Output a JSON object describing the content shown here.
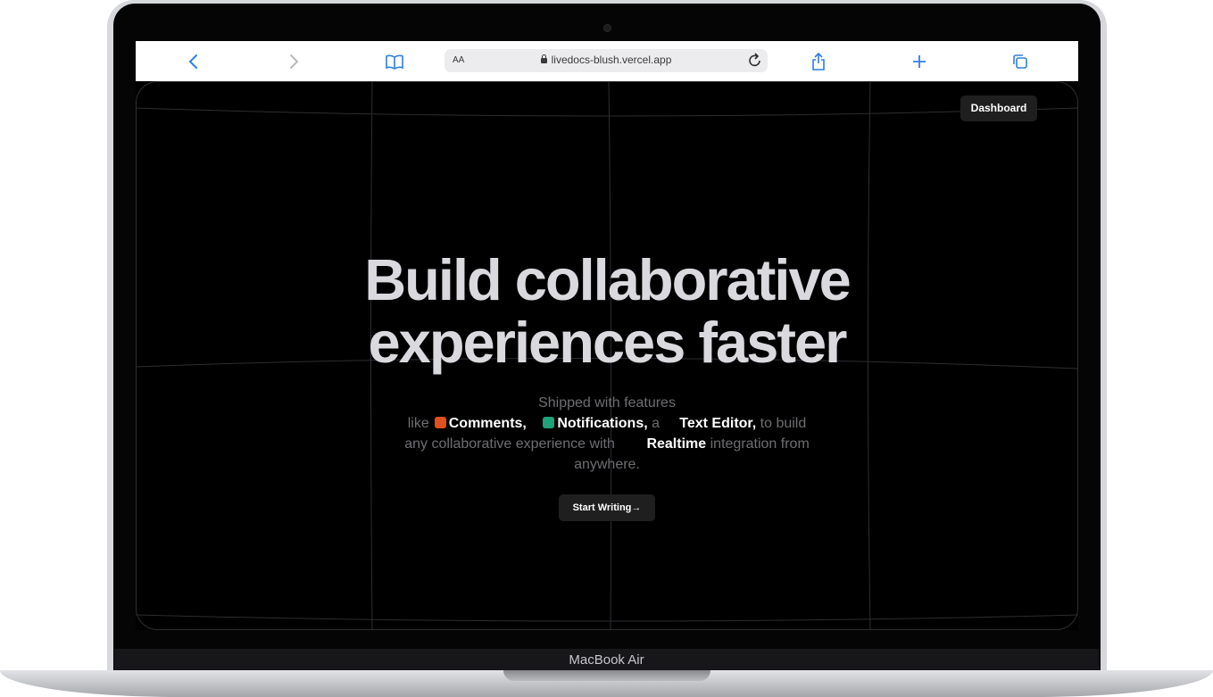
{
  "browser": {
    "aa_label": "AA",
    "url": "livedocs-blush.vercel.app",
    "icons": [
      "back-icon",
      "forward-icon",
      "bookmarks-icon",
      "reload-icon",
      "share-icon",
      "new-tab-icon",
      "tabs-icon"
    ]
  },
  "device": {
    "model": "MacBook Air"
  },
  "nav": {
    "dashboard_label": "Dashboard"
  },
  "hero": {
    "title_line1": "Build collaborative",
    "title_line2": "experiences faster",
    "desc_1": "Shipped with features",
    "desc_like": "like",
    "comments": "Comments,",
    "notifications": "Notifications,",
    "desc_a": "a",
    "text_editor": "Text Editor,",
    "desc_to_build": "to build",
    "desc_any": "any collaborative experience with",
    "realtime": "Realtime",
    "desc_integration": "integration from",
    "desc_anywhere": "anywhere.",
    "cta_label": "Start Writing",
    "cta_arrow": "→"
  },
  "colors": {
    "comments_icon": "#e0501e",
    "notifications_icon": "#1fa37a",
    "accent_link": "#2f7fe0"
  }
}
